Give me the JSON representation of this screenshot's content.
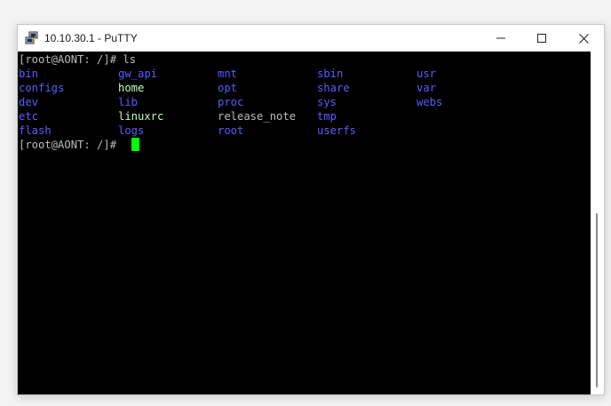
{
  "window": {
    "title": "10.10.30.1 - PuTTY",
    "icons": {
      "app": "putty-icon",
      "minimize": "minimize-icon",
      "maximize": "maximize-icon",
      "close": "close-icon"
    }
  },
  "terminal": {
    "prompt_line": "[root@AONT: /]# ls",
    "final_prompt": "[root@AONT: /]# ",
    "listing": {
      "row1": [
        "bin",
        "gw_api",
        "mnt",
        "sbin",
        "usr"
      ],
      "row2": [
        "configs",
        "home",
        "opt",
        "share",
        "var"
      ],
      "row3": [
        "dev",
        "lib",
        "proc",
        "sys",
        "webs"
      ],
      "row4": [
        "etc",
        "linuxrc",
        "release_note",
        "tmp"
      ],
      "row5": [
        "flash",
        "logs",
        "root",
        "userfs"
      ]
    },
    "colors": {
      "background": "#000000",
      "foreground": "#bbbbbb",
      "directory": "#5c5cff",
      "symlink": "#bbffbb",
      "cursor": "#00ff00"
    }
  }
}
